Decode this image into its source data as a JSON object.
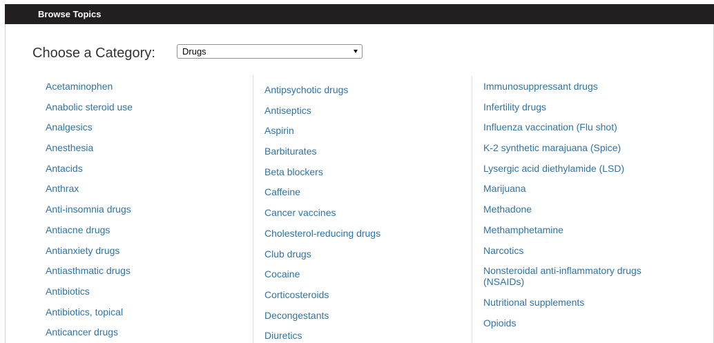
{
  "header": {
    "title": "Browse Topics"
  },
  "category": {
    "label": "Choose a Category:",
    "selected": "Drugs"
  },
  "columns": [
    [
      "Acetaminophen",
      "Anabolic steroid use",
      "Analgesics",
      "Anesthesia",
      "Antacids",
      "Anthrax",
      "Anti-insomnia drugs",
      "Antiacne drugs",
      "Antianxiety drugs",
      "Antiasthmatic drugs",
      "Antibiotics",
      "Antibiotics, topical",
      "Anticancer drugs"
    ],
    [
      "Antipsychotic drugs",
      "Antiseptics",
      "Aspirin",
      "Barbiturates",
      "Beta blockers",
      "Caffeine",
      "Cancer vaccines",
      "Cholesterol-reducing drugs",
      "Club drugs",
      "Cocaine",
      "Corticosteroids",
      "Decongestants",
      "Diuretics"
    ],
    [
      "Immunosuppressant drugs",
      "Infertility drugs",
      "Influenza vaccination (Flu shot)",
      "K-2 synthetic marajuana (Spice)",
      "Lysergic acid diethylamide (LSD)",
      "Marijuana",
      "Methadone",
      "Methamphetamine",
      "Narcotics",
      "Nonsteroidal anti-inflammatory drugs (NSAIDs)",
      "Nutritional supplements",
      "Opioids"
    ]
  ],
  "colors": {
    "link": "#2e73a8",
    "header_bg": "#231f20"
  }
}
